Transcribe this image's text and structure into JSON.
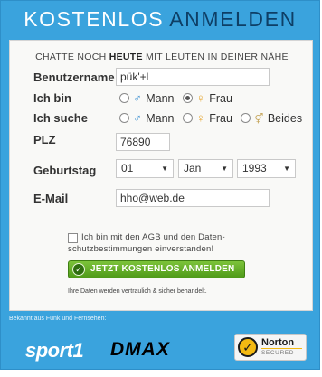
{
  "header": {
    "word1": "KOSTENLOS",
    "word2": "ANMELDEN"
  },
  "subhead": {
    "prefix": "CHATTE NOCH",
    "bold": "HEUTE",
    "suffix": "MIT LEUTEN IN DEINER NÄHE"
  },
  "form": {
    "username": {
      "label": "Benutzername",
      "value": "pük'+l"
    },
    "gender": {
      "label": "Ich bin",
      "options": [
        "Mann",
        "Frau"
      ],
      "selected": "Frau"
    },
    "seeking": {
      "label": "Ich suche",
      "options": [
        "Mann",
        "Frau",
        "Beides"
      ],
      "selected": ""
    },
    "plz": {
      "label": "PLZ",
      "value": "76890"
    },
    "birthday": {
      "label": "Geburtstag",
      "day": "01",
      "month": "Jan",
      "year": "1993"
    },
    "email": {
      "label": "E-Mail",
      "value": "hho@web.de"
    }
  },
  "consent": {
    "text": "Ich bin mit den AGB und den Daten-schutzbestimmungen einverstanden!"
  },
  "cta": {
    "label": "JETZT KOSTENLOS ANMELDEN",
    "color": "#5ea826"
  },
  "fineprint": "Ihre Daten werden vertraulich & sicher behandelt.",
  "footer": {
    "known_from": "Bekannt aus Funk und Fernsehen:",
    "logo1": "sport1",
    "logo2": "DMAX",
    "badge_title": "Norton",
    "badge_sub": "SECURED"
  },
  "colors": {
    "frame": "#3aa3dd",
    "header_dark": "#0e3f66"
  }
}
